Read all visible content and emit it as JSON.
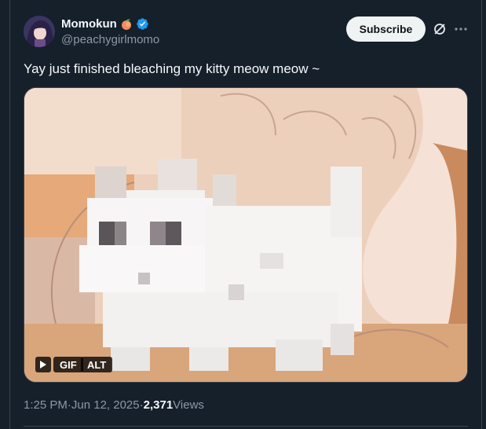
{
  "author": {
    "display_name": "Momokun",
    "handle": "@peachygirlmomo",
    "badge_emoji": "peach-emoji",
    "verified": true
  },
  "actions": {
    "subscribe_label": "Subscribe",
    "grok_icon": "grok-icon",
    "more_icon": "more-icon"
  },
  "tweet": {
    "text": "Yay just finished bleaching my kitty meow meow ~",
    "media": {
      "type": "gif",
      "gif_label": "GIF",
      "alt_label": "ALT"
    }
  },
  "meta": {
    "time": "1:25 PM",
    "separator": " · ",
    "date": "Jun 12, 2025",
    "views_count": "2,371",
    "views_label": " Views"
  },
  "colors": {
    "background": "#15202b",
    "text_primary": "#f7f9f9",
    "text_secondary": "#8b98a5",
    "verified_blue": "#1d9bf0",
    "button_bg": "#eff3f4",
    "border": "#38444d"
  }
}
